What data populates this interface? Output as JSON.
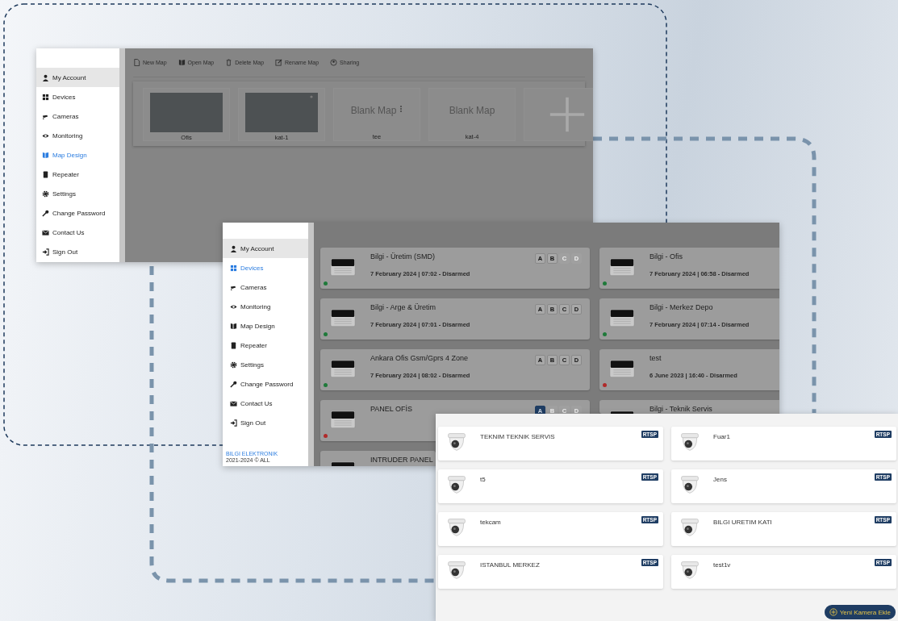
{
  "map_window": {
    "sidebar": [
      {
        "label": "My Account",
        "selected": false,
        "hovered": true
      },
      {
        "label": "Devices",
        "selected": false,
        "hovered": false
      },
      {
        "label": "Cameras",
        "selected": false,
        "hovered": false
      },
      {
        "label": "Monitoring",
        "selected": false,
        "hovered": false
      },
      {
        "label": "Map Design",
        "selected": true,
        "hovered": false
      },
      {
        "label": "Repeater",
        "selected": false,
        "hovered": false
      },
      {
        "label": "Settings",
        "selected": false,
        "hovered": false
      },
      {
        "label": "Change Password",
        "selected": false,
        "hovered": false
      },
      {
        "label": "Contact Us",
        "selected": false,
        "hovered": false
      },
      {
        "label": "Sign Out",
        "selected": false,
        "hovered": false
      }
    ],
    "toolbar": [
      "New Map",
      "Open Map",
      "Delete Map",
      "Rename Map",
      "Sharing"
    ],
    "maps": [
      {
        "kind": "photo",
        "name": "Ofis",
        "menu": false
      },
      {
        "kind": "photo",
        "name": "kat-1",
        "menu": true
      },
      {
        "kind": "blank",
        "placeholder_text": "Blank Map",
        "name": "tee",
        "menu": true
      },
      {
        "kind": "blank",
        "placeholder_text": "Blank Map",
        "name": "kat-4",
        "menu": false
      },
      {
        "kind": "add"
      }
    ]
  },
  "devices_window": {
    "sidebar": [
      {
        "label": "My Account",
        "selected": false,
        "hovered": true
      },
      {
        "label": "Devices",
        "selected": true,
        "hovered": false
      },
      {
        "label": "Cameras",
        "selected": false,
        "hovered": false
      },
      {
        "label": "Monitoring",
        "selected": false,
        "hovered": false
      },
      {
        "label": "Map Design",
        "selected": false,
        "hovered": false
      },
      {
        "label": "Repeater",
        "selected": false,
        "hovered": false
      },
      {
        "label": "Settings",
        "selected": false,
        "hovered": false
      },
      {
        "label": "Change Password",
        "selected": false,
        "hovered": false
      },
      {
        "label": "Contact Us",
        "selected": false,
        "hovered": false
      },
      {
        "label": "Sign Out",
        "selected": false,
        "hovered": false
      }
    ],
    "footer_brand": "BILGI ELEKTRONIK",
    "footer_text": "2021-2024 © ALL",
    "devices": [
      {
        "name": "Bilgi - Üretim (SMD)",
        "status": "7 February 2024 | 07:02 - Disarmed",
        "color": "#1f7a3a",
        "partitions": [
          {
            "label": "A",
            "enabled": true,
            "armed": false
          },
          {
            "label": "B",
            "enabled": true,
            "armed": false
          },
          {
            "label": "C",
            "enabled": false,
            "armed": false
          },
          {
            "label": "D",
            "enabled": false,
            "armed": false
          }
        ]
      },
      {
        "name": "Bilgi - Ofis",
        "status": "7 February 2024 | 06:58 - Disarmed",
        "color": "#1f7a3a"
      },
      {
        "name": "Bilgi - Arge & Üretim",
        "status": "7 February 2024 | 07:01 - Disarmed",
        "color": "#1f7a3a",
        "partitions": [
          {
            "label": "A",
            "enabled": true,
            "armed": false
          },
          {
            "label": "B",
            "enabled": true,
            "armed": false
          },
          {
            "label": "C",
            "enabled": true,
            "armed": false
          },
          {
            "label": "D",
            "enabled": true,
            "armed": false
          }
        ]
      },
      {
        "name": "Bilgi - Merkez Depo",
        "status": "7 February 2024 | 07:14 - Disarmed",
        "color": "#1f7a3a"
      },
      {
        "name": "Ankara Ofis Gsm/Gprs 4 Zone",
        "status": "7 February 2024 | 08:02 - Disarmed",
        "color": "#1f7a3a",
        "partitions": [
          {
            "label": "A",
            "enabled": true,
            "armed": false
          },
          {
            "label": "B",
            "enabled": true,
            "armed": false
          },
          {
            "label": "C",
            "enabled": true,
            "armed": false
          },
          {
            "label": "D",
            "enabled": true,
            "armed": false
          }
        ]
      },
      {
        "name": "test",
        "status": "6 June 2023 | 16:40 - Disarmed",
        "color": "#b02a2a"
      },
      {
        "name": "PANEL OFİS",
        "color": "#b02a2a",
        "partitions": [
          {
            "label": "A",
            "enabled": true,
            "armed": true
          },
          {
            "label": "B",
            "enabled": false,
            "armed": false
          },
          {
            "label": "C",
            "enabled": false,
            "armed": false
          },
          {
            "label": "D",
            "enabled": false,
            "armed": false
          }
        ]
      },
      {
        "name": "Bilgi - Teknik Servis"
      },
      {
        "name": "INTRUDER PANEL"
      }
    ]
  },
  "cameras_window": {
    "cameras": [
      {
        "name": "TEKNIM TEKNIK SERVIS",
        "protocol": "RTSP"
      },
      {
        "name": "Fuar1",
        "protocol": "RTSP"
      },
      {
        "name": "t5",
        "protocol": "RTSP"
      },
      {
        "name": "Jens",
        "protocol": "RTSP"
      },
      {
        "name": "tekcam",
        "protocol": "RTSP"
      },
      {
        "name": "BILGI URETIM KATI",
        "protocol": "RTSP"
      },
      {
        "name": "ISTANBUL MERKEZ",
        "protocol": "RTSP"
      },
      {
        "name": "test1v",
        "protocol": "RTSP"
      }
    ],
    "add_button": "Yeni Kamera Ekle"
  }
}
